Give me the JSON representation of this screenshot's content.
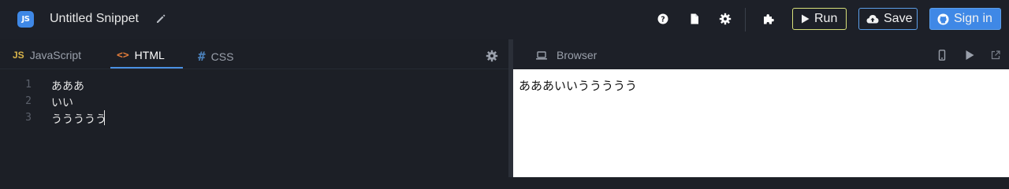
{
  "app": {
    "logo_text": "JS",
    "title": "Untitled Snippet"
  },
  "header": {
    "icons": [
      "help-icon",
      "document-icon",
      "settings-icon",
      "extensions-icon"
    ],
    "run_label": "Run",
    "save_label": "Save",
    "signin_label": "Sign in"
  },
  "editor": {
    "tabs": [
      {
        "icon_text": "JS",
        "label": "JavaScript"
      },
      {
        "icon_text": "<>",
        "label": "HTML"
      },
      {
        "icon_text": "#",
        "label": "CSS"
      }
    ],
    "active_tab": "HTML",
    "lines": [
      {
        "number": "1",
        "text": "あああ"
      },
      {
        "number": "2",
        "text": "いい"
      },
      {
        "number": "3",
        "text": "ううううう"
      }
    ]
  },
  "browser": {
    "tab_label": "Browser",
    "content_text": "あああいいううううう"
  },
  "colors": {
    "accent": "#3f88e6",
    "run_border": "#d8e07a",
    "html_icon": "#e07b39",
    "js_icon": "#d9b44a",
    "css_icon": "#4a7fb8"
  }
}
